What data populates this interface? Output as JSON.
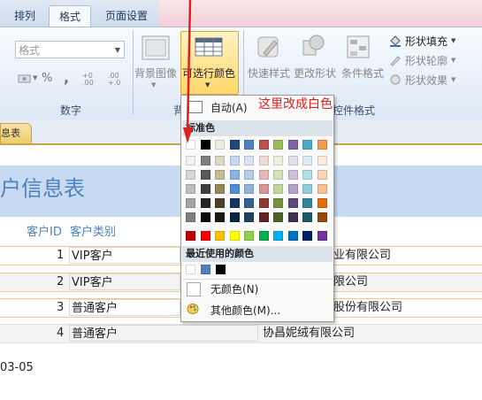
{
  "ribbon": {
    "tabs": [
      {
        "label": "排列"
      },
      {
        "label": "格式"
      },
      {
        "label": "页面设置"
      }
    ],
    "format_combo_value": "格式",
    "number_group_label": "数字",
    "background_image_label": "背景图像",
    "alternate_color_label": "可选行颜色",
    "quick_styles_label": "快速样式",
    "change_shape_label": "更改形状",
    "conditional_format_label": "条件格式",
    "shape_fill_label": "形状填充",
    "shape_outline_label": "形状轮廓",
    "shape_effects_label": "形状效果",
    "bg_group_label": "背",
    "controls_group_label": "控件格式",
    "percent_symbol": "%"
  },
  "annotation": {
    "text": "这里改成白色",
    "color": "#e0201f"
  },
  "document": {
    "tab_label": "息表",
    "title": "户信息表",
    "column_headers": [
      "客户ID",
      "客户类别"
    ],
    "rows": [
      {
        "id": "1",
        "category": "VIP客户",
        "company": "业有限公司"
      },
      {
        "id": "2",
        "category": "VIP客户",
        "company": "限公司"
      },
      {
        "id": "3",
        "category": "普通客户",
        "company": "股份有限公司"
      },
      {
        "id": "4",
        "category": "普通客户",
        "company": "协昌妮绒有限公司"
      }
    ],
    "footer_date": "03-05"
  },
  "color_menu": {
    "automatic_label": "自动(A)",
    "standard_colors_label": "标准色",
    "recent_colors_label": "最近使用的颜色",
    "no_color_label": "无颜色(N)",
    "more_colors_label": "其他颜色(M)...",
    "top_row": [
      "#ffffff",
      "#000000",
      "#eeece1",
      "#1f497d",
      "#4f81bd",
      "#c0504d",
      "#9bbb59",
      "#8064a2",
      "#4bacc6",
      "#f79646"
    ],
    "shade_rows": [
      [
        "#f2f2f2",
        "#7f7f7f",
        "#ddd9c3",
        "#c6d9f0",
        "#dbe5f1",
        "#f2dcdb",
        "#ebf1dd",
        "#e5e0ec",
        "#dbeef3",
        "#fdeada"
      ],
      [
        "#d8d8d8",
        "#595959",
        "#c4bd97",
        "#8db3e2",
        "#b8cce4",
        "#e5b9b7",
        "#d7e3bc",
        "#ccc1d9",
        "#b7dde8",
        "#fbd5b5"
      ],
      [
        "#bfbfbf",
        "#3f3f3f",
        "#938953",
        "#548dd4",
        "#95b3d7",
        "#d99694",
        "#c3d69b",
        "#b2a2c7",
        "#92cddc",
        "#fac08f"
      ],
      [
        "#a5a5a5",
        "#262626",
        "#494429",
        "#17365d",
        "#366092",
        "#953734",
        "#76923c",
        "#5f497a",
        "#31859b",
        "#e36c09"
      ],
      [
        "#7f7f7f",
        "#0c0c0c",
        "#1d1b10",
        "#0f243e",
        "#244061",
        "#632423",
        "#4f6128",
        "#3f3151",
        "#205867",
        "#974806"
      ]
    ],
    "standard_row": [
      "#c00000",
      "#ff0000",
      "#ffc000",
      "#ffff00",
      "#92d050",
      "#00b050",
      "#00b0f0",
      "#0070c0",
      "#002060",
      "#7030a0"
    ],
    "recent_row": [
      "#ffffff",
      "#4f81bd",
      "#000000"
    ]
  }
}
